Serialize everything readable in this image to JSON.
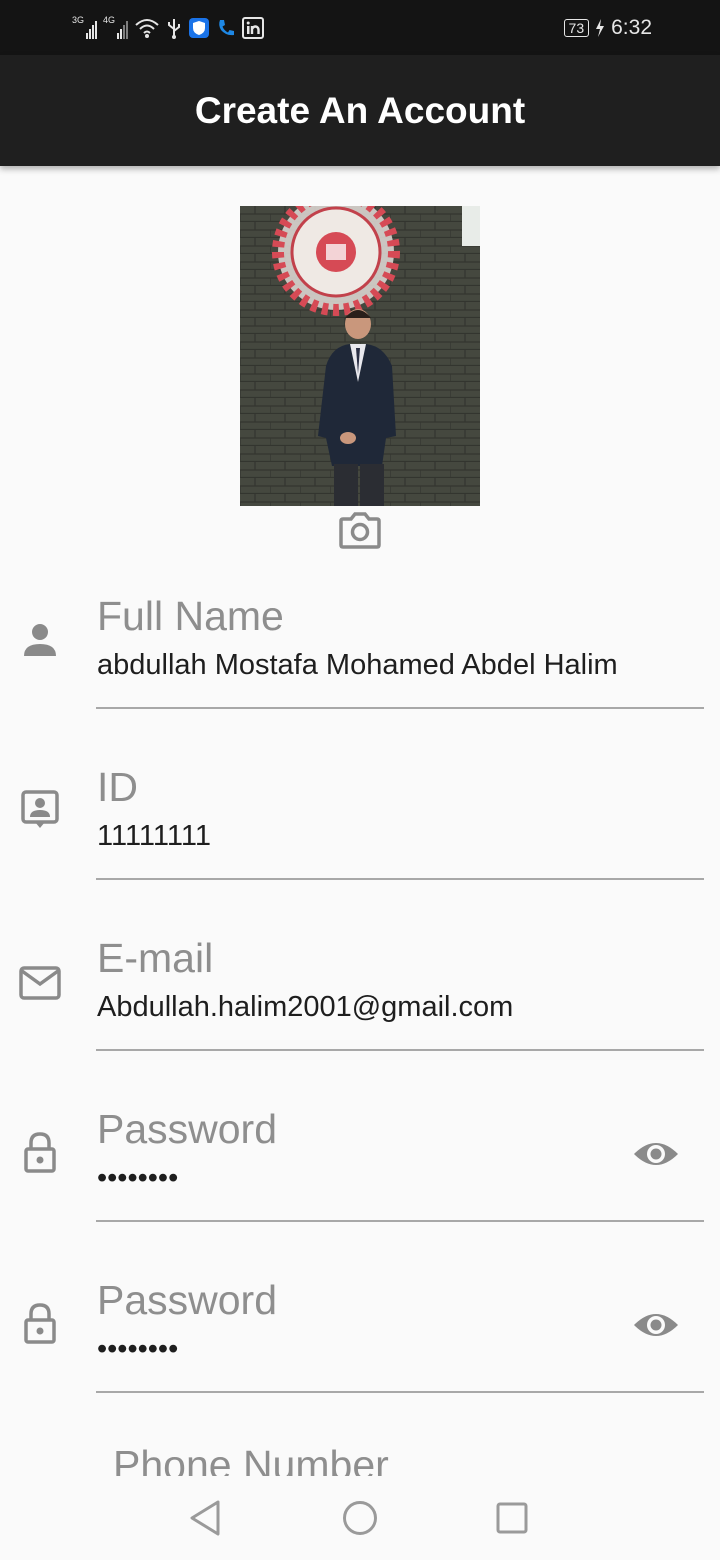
{
  "status_bar": {
    "net1": "3G",
    "net2": "4G",
    "battery": "73",
    "time": "6:32"
  },
  "header": {
    "title": "Create An Account"
  },
  "form": {
    "full_name": {
      "label": "Full Name",
      "value": "abdullah Mostafa Mohamed Abdel Halim",
      "icon": "person-icon"
    },
    "id": {
      "label": "ID",
      "value": "11111111",
      "icon": "contact-badge-icon"
    },
    "email": {
      "label": "E-mail",
      "value": "Abdullah.halim2001@gmail.com",
      "icon": "mail-icon"
    },
    "password": {
      "label": "Password",
      "value": "••••••••",
      "icon": "lock-icon"
    },
    "confirm_password": {
      "label": "Password",
      "value": "••••••••",
      "icon": "lock-icon"
    },
    "phone": {
      "label": "Phone Number"
    }
  },
  "colors": {
    "app_bar": "#1f1f1f",
    "status_bar": "#141414",
    "background": "#fafafa",
    "label": "#8e8e8e",
    "icon": "#8a8a8a"
  }
}
